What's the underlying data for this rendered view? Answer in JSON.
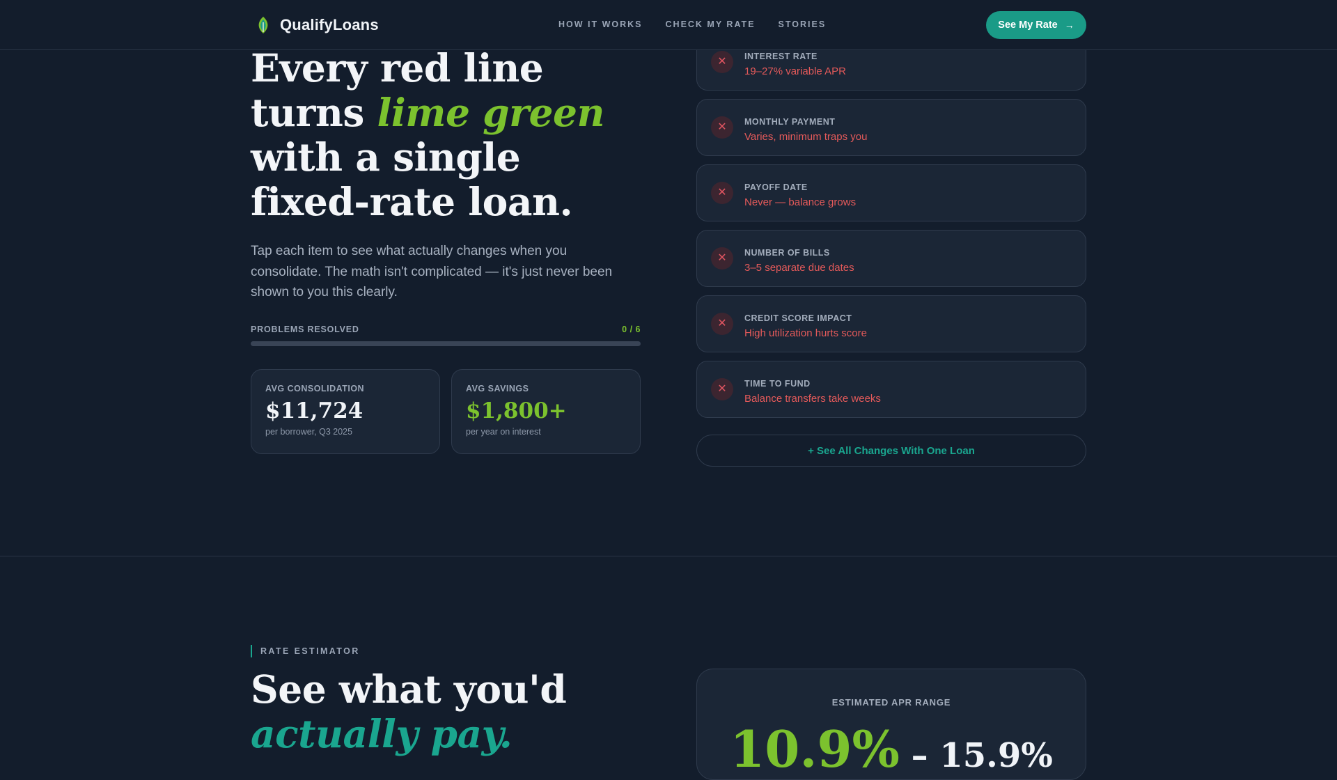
{
  "brand": {
    "name": "QualifyLoans"
  },
  "nav": {
    "links": [
      "HOW IT WORKS",
      "CHECK MY RATE",
      "STORIES"
    ],
    "cta_label": "See My Rate",
    "cta_icon": "arrow-right-icon"
  },
  "hero": {
    "title_part1": "Every red line turns",
    "title_highlight": "lime green",
    "title_part2": "with a single fixed-rate loan.",
    "subtitle": "Tap each item to see what actually changes when you consolidate. The math isn't complicated — it's just never been shown to you this clearly.",
    "progress": {
      "label": "PROBLEMS RESOLVED",
      "count": "0 / 6",
      "fraction": 0
    },
    "stats": [
      {
        "label": "AVG CONSOLIDATION",
        "value": "$11,724",
        "note": "per borrower, Q3 2025"
      },
      {
        "label": "AVG SAVINGS",
        "value": "$1,800+",
        "note": "per year on interest"
      }
    ]
  },
  "problems": [
    {
      "title": "INTEREST RATE",
      "desc": "19–27% variable APR"
    },
    {
      "title": "MONTHLY PAYMENT",
      "desc": "Varies, minimum traps you"
    },
    {
      "title": "PAYOFF DATE",
      "desc": "Never — balance grows"
    },
    {
      "title": "NUMBER OF BILLS",
      "desc": "3–5 separate due dates"
    },
    {
      "title": "CREDIT SCORE IMPACT",
      "desc": "High utilization hurts score"
    },
    {
      "title": "TIME TO FUND",
      "desc": "Balance transfers take weeks"
    }
  ],
  "all_changes_label": "+ See All Changes With One Loan",
  "estimator": {
    "eyebrow": "RATE ESTIMATOR",
    "title_part1": "See what you'd",
    "title_highlight": "actually pay.",
    "card_label": "ESTIMATED APR RANGE",
    "apr_low": "10.9%",
    "apr_sep": " – ",
    "apr_high": "15.9%"
  },
  "colors": {
    "background": "#131d2c",
    "card": "#1b2636",
    "accent_teal": "#1a9b87",
    "accent_lime": "#7cc22e",
    "problem_red": "#e55a5a"
  }
}
